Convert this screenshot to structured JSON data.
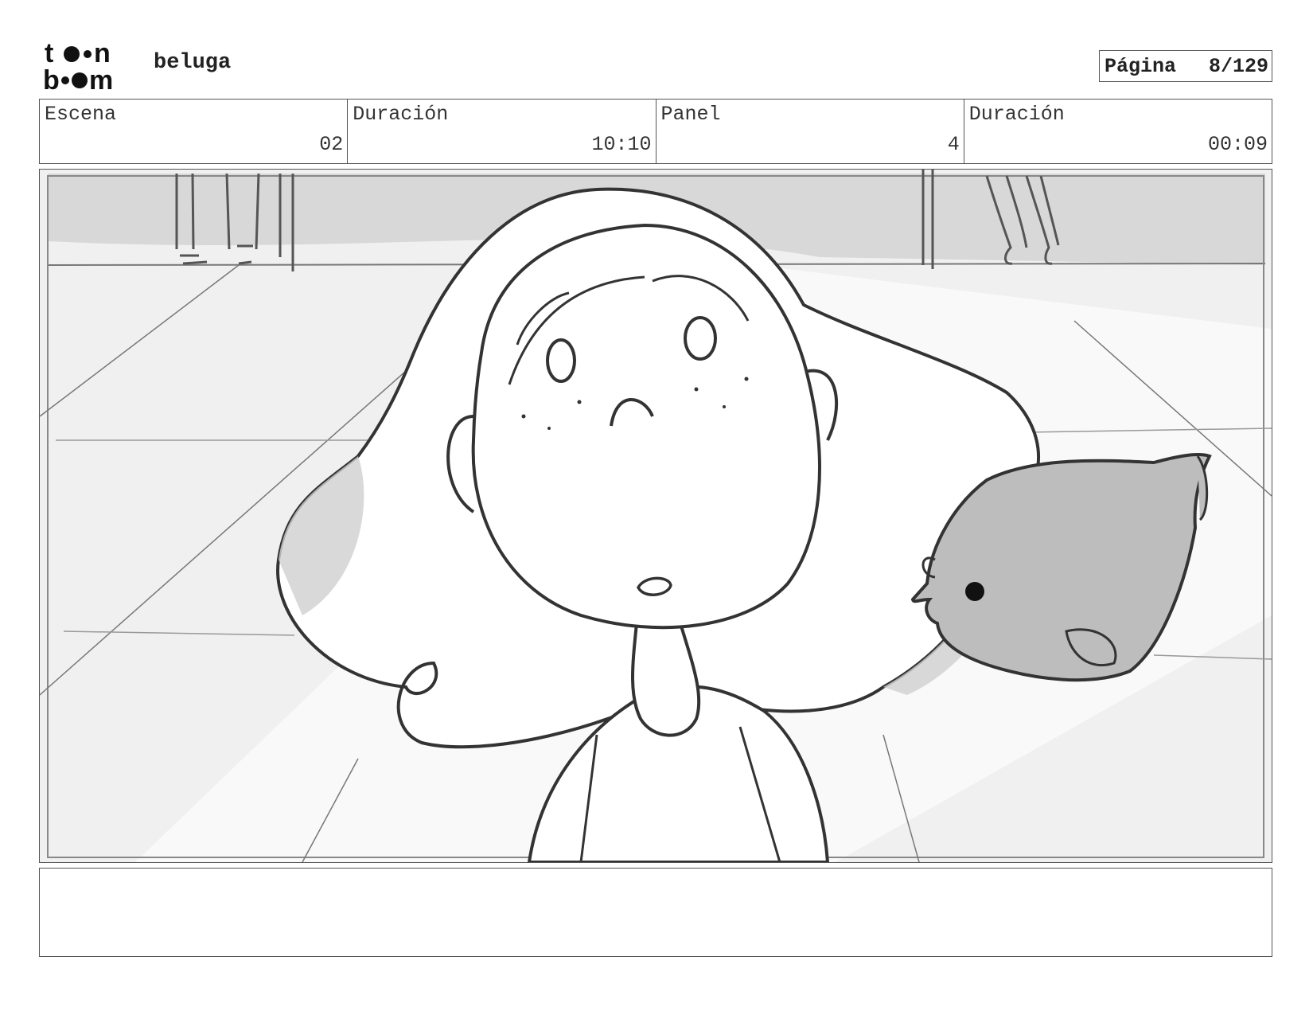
{
  "header": {
    "logo_top": "to•n",
    "logo_bottom": "b••m",
    "project_title": "beluga",
    "page_label": "Página",
    "page_value": "8/129"
  },
  "info": {
    "scene_label": "Escena",
    "scene_value": "02",
    "scene_duration_label": "Duración",
    "scene_duration_value": "10:10",
    "panel_label": "Panel",
    "panel_value": "4",
    "panel_duration_label": "Duración",
    "panel_duration_value": "00:09"
  },
  "notes": {
    "text": ""
  },
  "colors": {
    "line": "#333333",
    "light_gray": "#eeeeee",
    "mid_gray": "#c8c8c8",
    "fish_gray": "#bdbdbd"
  }
}
